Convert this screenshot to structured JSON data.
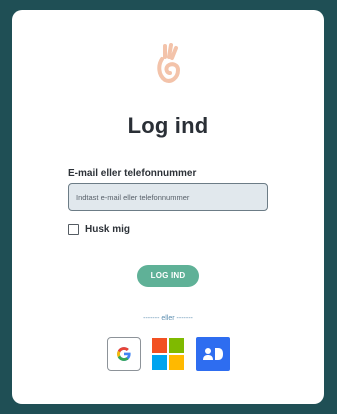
{
  "title": "Log ind",
  "email": {
    "label": "E-mail eller telefonnummer",
    "placeholder": "Indtast e-mail eller telefonnummer",
    "value": ""
  },
  "remember": {
    "label": "Husk mig",
    "checked": false
  },
  "login_button": "LOG IND",
  "divider": "------- eller -------",
  "providers": [
    {
      "name": "google",
      "icon": "google-icon"
    },
    {
      "name": "microsoft",
      "icon": "microsoft-icon"
    },
    {
      "name": "id",
      "icon": "id-icon"
    }
  ],
  "colors": {
    "background": "#1f4f55",
    "card": "#ffffff",
    "logo": "#f3c3aa",
    "button": "#5fb197",
    "divider": "#5e8fb1",
    "id_provider": "#2e6df0"
  }
}
